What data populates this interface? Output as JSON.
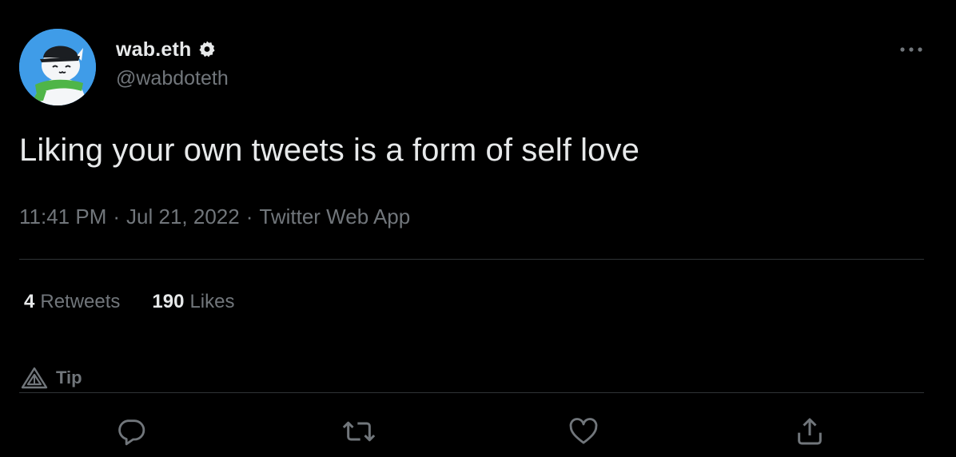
{
  "author": {
    "display_name": "wab.eth",
    "handle": "@wabdoteth",
    "verified_icon": "verified-badge-icon",
    "avatar_icon": "cat-with-cap-avatar"
  },
  "more_icon": "more-dots-icon",
  "tweet": {
    "text": "Liking your own tweets is a form of self love",
    "time": "11:41 PM",
    "date": "Jul 21, 2022",
    "separator": "·",
    "source": "Twitter Web App"
  },
  "stats": {
    "retweets_count": "4",
    "retweets_label": "Retweets",
    "likes_count": "190",
    "likes_label": "Likes"
  },
  "tip": {
    "label": "Tip",
    "icon": "tip-triangle-icon"
  },
  "actions": [
    {
      "icon": "reply-icon"
    },
    {
      "icon": "retweet-icon"
    },
    {
      "icon": "like-heart-icon"
    },
    {
      "icon": "share-upload-icon"
    }
  ],
  "colors": {
    "background": "#000000",
    "primary_text": "#e7e9ea",
    "secondary_text": "#71767b",
    "divider": "#2f3336",
    "avatar_bg": "#3f9ce8"
  }
}
